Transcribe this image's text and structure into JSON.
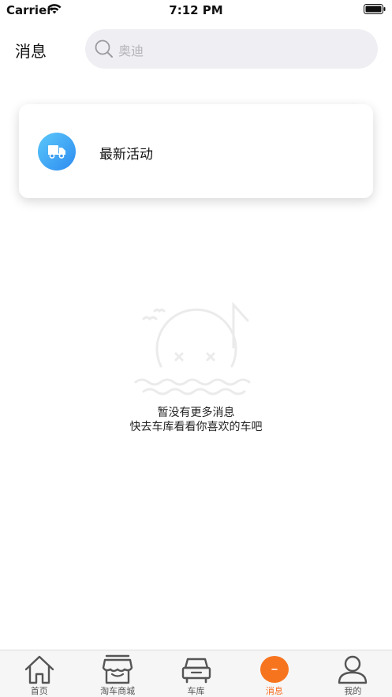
{
  "status_bar": {
    "carrier": "Carrier",
    "time": "7:12 PM"
  },
  "header": {
    "title": "消息",
    "search_placeholder": "奥迪"
  },
  "activity": {
    "label": "最新活动",
    "icon": "truck-icon"
  },
  "empty_state": {
    "line1": "暂没有更多消息",
    "line2": "快去车库看看你喜欢的车吧"
  },
  "tab_bar": {
    "active_color": "#f76b1c",
    "items": [
      {
        "label": "首页",
        "icon": "home-icon"
      },
      {
        "label": "淘车商城",
        "icon": "store-icon"
      },
      {
        "label": "车库",
        "icon": "car-icon"
      },
      {
        "label": "消息",
        "icon": "message-icon"
      },
      {
        "label": "我的",
        "icon": "user-icon"
      }
    ]
  }
}
